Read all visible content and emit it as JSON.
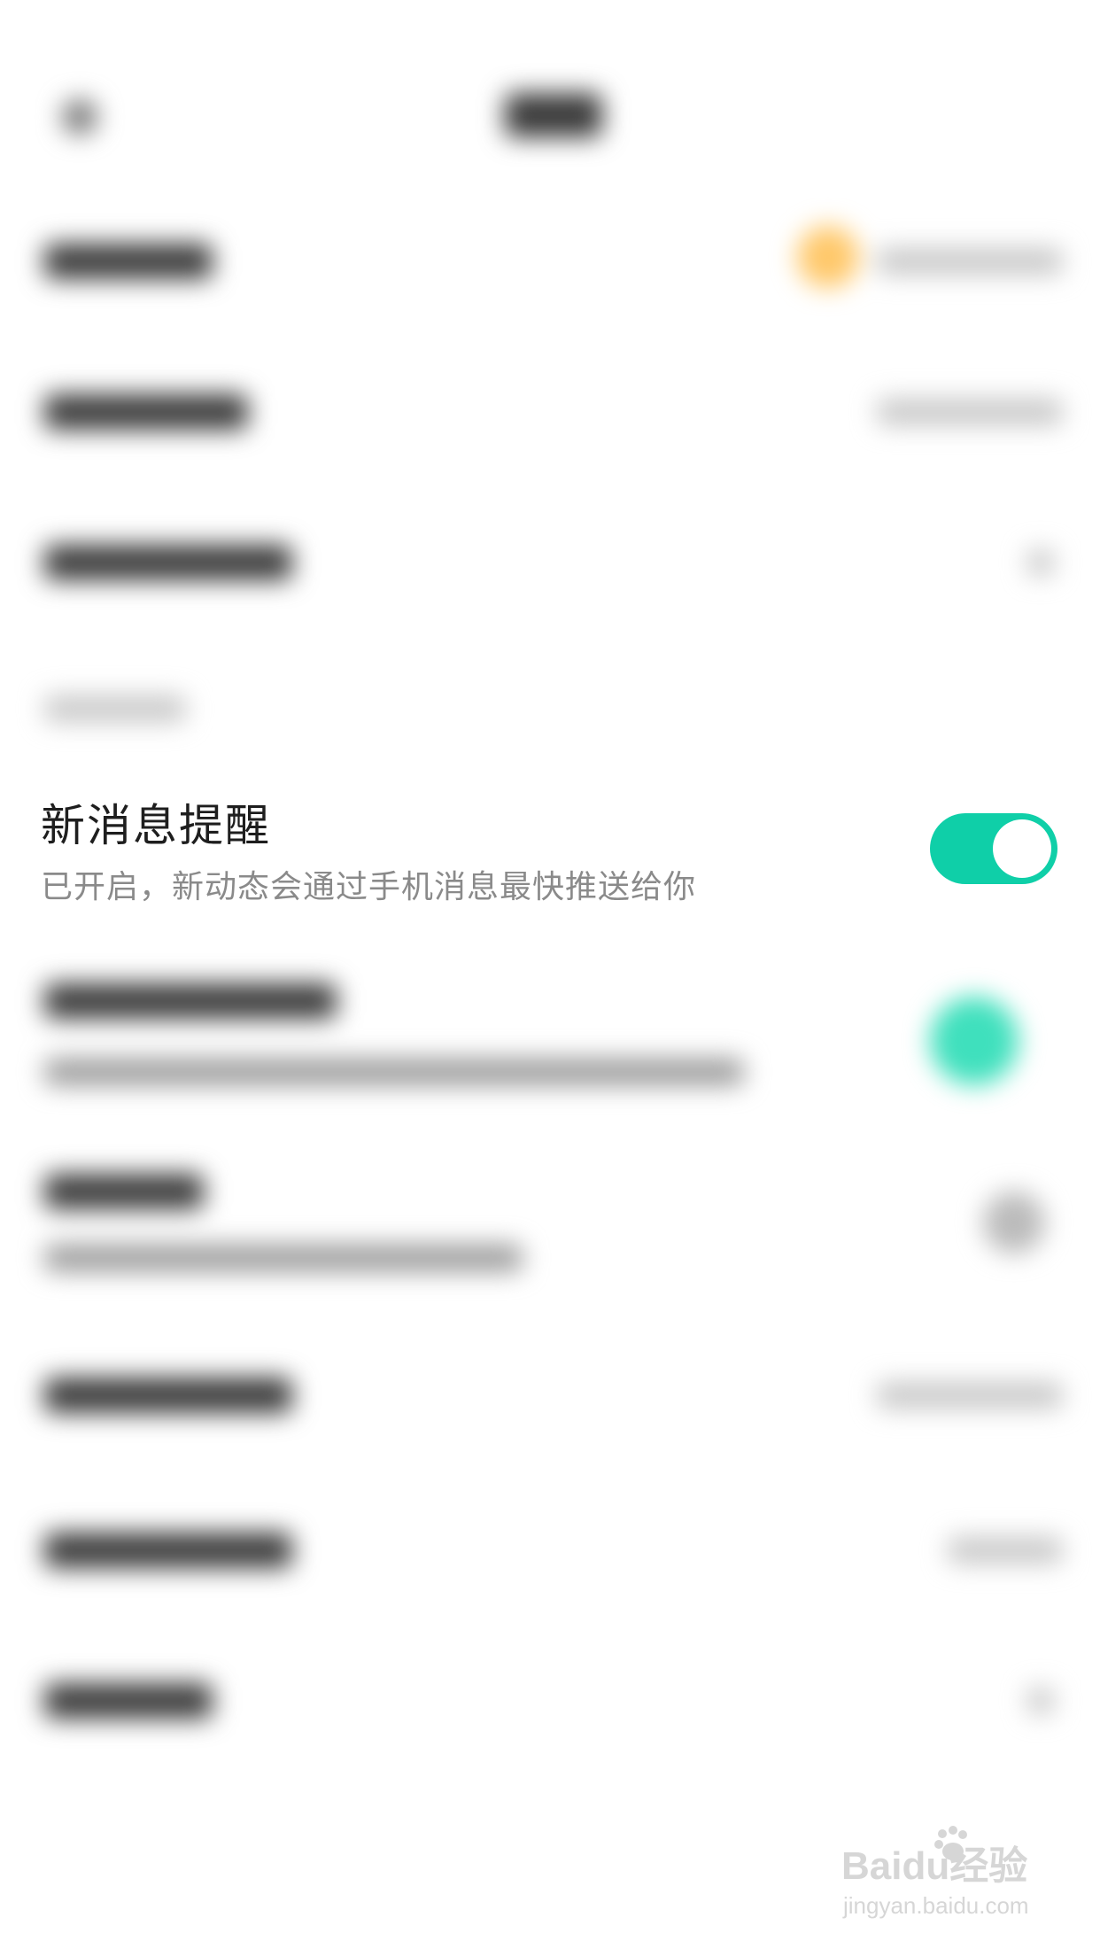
{
  "notification_setting": {
    "title": "新消息提醒",
    "subtitle": "已开启，新动态会通过手机消息最快推送给你",
    "toggle_on": true
  },
  "colors": {
    "toggle_on": "#0fcfa8",
    "title_text": "#1e1e1e",
    "subtitle_text": "#8a8a8a",
    "accent_orange": "#ffc86a"
  },
  "watermark": {
    "logo_text": "Baidu经验",
    "url": "jingyan.baidu.com"
  }
}
